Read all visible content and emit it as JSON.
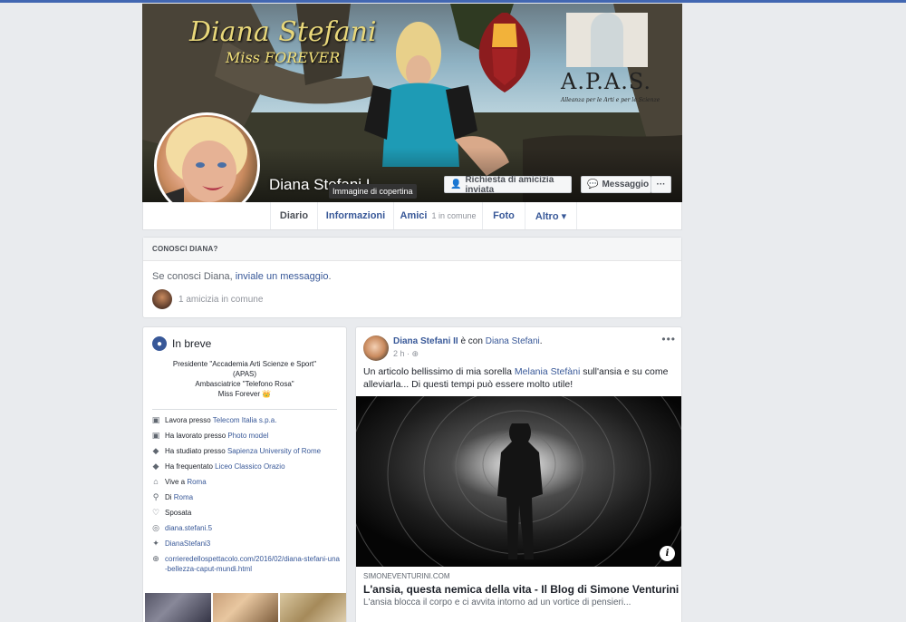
{
  "cover": {
    "script_name": "Diana Stefani",
    "script_sub": "Miss FOREVER",
    "apas": "A.P.A.S.",
    "apas_sub": "Alleanza per le Arti e per le Scienze"
  },
  "profile": {
    "name": "Diana Stefani I",
    "tooltip": "Immagine di copertina",
    "friend_request_label": "Richiesta di amicizia inviata",
    "message_label": "Messaggio",
    "more_label": "···"
  },
  "tabs": [
    {
      "label": "Diario",
      "count": ""
    },
    {
      "label": "Informazioni",
      "count": ""
    },
    {
      "label": "Amici",
      "count": "1 in comune"
    },
    {
      "label": "Foto",
      "count": ""
    },
    {
      "label": "Altro ▾",
      "count": ""
    }
  ],
  "know": {
    "title": "CONOSCI DIANA?",
    "text_prefix": "Se conosci Diana, ",
    "text_link": "inviale un messaggio",
    "text_suffix": ".",
    "mutual": "1 amicizia in comune"
  },
  "intro": {
    "title": "In breve",
    "bio_lines": [
      "Presidente \"Accademia Arti Scienze e Sport\"",
      "(APAS)",
      "Ambasciatrice \"Telefono Rosa\"",
      "Miss Forever 👑"
    ],
    "items": [
      {
        "icon": "briefcase-icon",
        "glyph": "▣",
        "text": "Lavora presso ",
        "link": "Telecom Italia s.p.a."
      },
      {
        "icon": "briefcase-icon",
        "glyph": "▣",
        "text": "Ha lavorato presso ",
        "link": "Photo model"
      },
      {
        "icon": "graduation-cap-icon",
        "glyph": "◆",
        "text": "Ha studiato presso ",
        "link": "Sapienza University of Rome"
      },
      {
        "icon": "graduation-cap-icon",
        "glyph": "◆",
        "text": "Ha frequentato ",
        "link": "Liceo Classico Orazio"
      },
      {
        "icon": "home-icon",
        "glyph": "⌂",
        "text": "Vive a ",
        "link": "Roma"
      },
      {
        "icon": "location-pin-icon",
        "glyph": "⚲",
        "text": "Di ",
        "link": "Roma"
      },
      {
        "icon": "heart-icon",
        "glyph": "♡",
        "text": "Sposata",
        "link": ""
      },
      {
        "icon": "instagram-icon",
        "glyph": "◎",
        "text": "",
        "link": "diana.stefani.5"
      },
      {
        "icon": "twitter-icon",
        "glyph": "✦",
        "text": "",
        "link": "DianaStefani3"
      },
      {
        "icon": "globe-icon",
        "glyph": "⊕",
        "text": "",
        "link": "corrieredellospettacolo.com/2016/02/diana-stefani-una-bellezza-caput-mundi.html"
      }
    ]
  },
  "post": {
    "author": "Diana Stefani II",
    "with_text": " è con ",
    "with_name": "Diana Stefani",
    "with_suffix": ".",
    "time": "2 h · ",
    "more": "•••",
    "text_prefix": "Un articolo bellissimo di mia sorella ",
    "text_link": "Melania Stefàni",
    "text_suffix": " sull'ansia e su come alleviarla... Di questi tempi può essere molto utile!",
    "link_domain": "SIMONEVENTURINI.COM",
    "link_title": "L'ansia, questa nemica della vita - Il Blog di Simone Venturini",
    "link_desc": "L'ansia blocca il corpo e ci avvita intorno ad un vortice di pensieri..."
  },
  "colors": {
    "link": "#385898",
    "topbar": "#4267b2",
    "background": "#e9ebee"
  }
}
